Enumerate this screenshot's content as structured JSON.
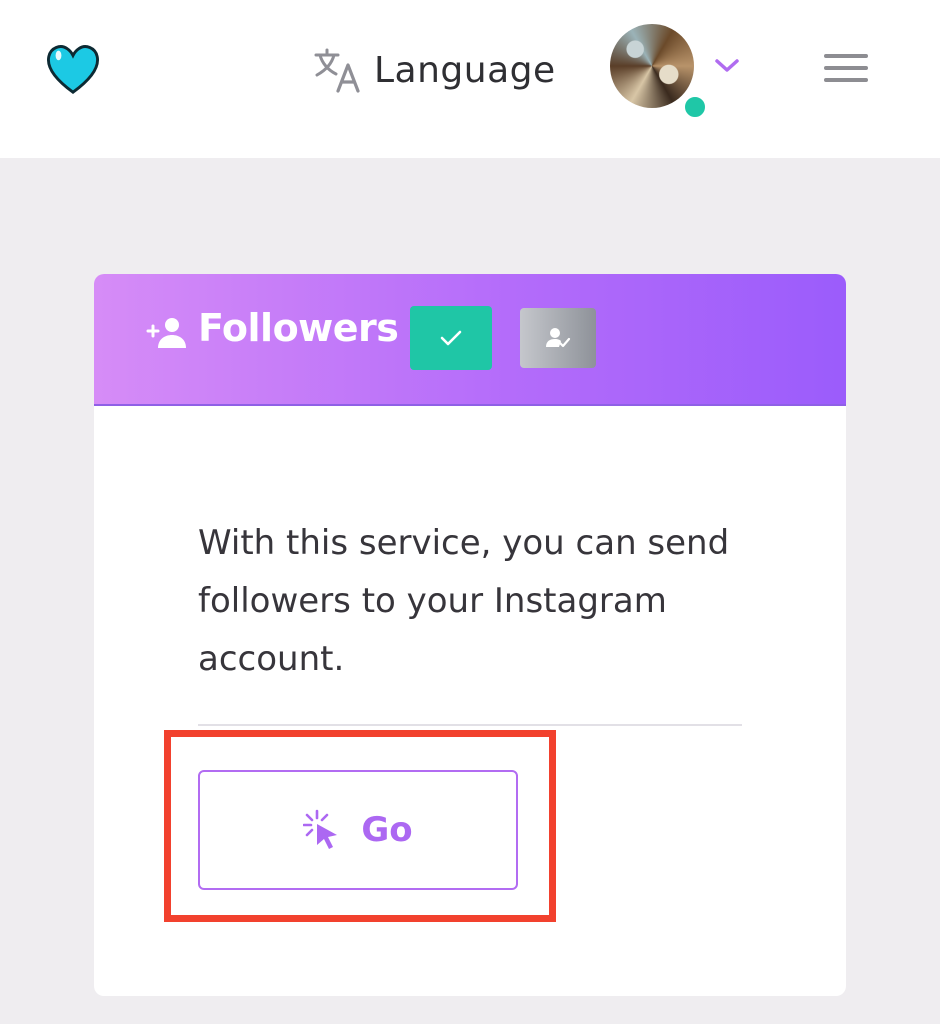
{
  "header": {
    "logo_icon": "heart-icon",
    "language_icon": "translate-icon",
    "language_label": "Language",
    "avatar_icon": "avatar-photo",
    "status_color": "#1fc7a7",
    "dropdown_icon": "chevron-down-icon",
    "menu_icon": "hamburger-menu-icon"
  },
  "card": {
    "title": "Followers",
    "title_icon": "add-person-icon",
    "tags": [
      {
        "icon": "check-icon",
        "color": "#1fc6a6"
      },
      {
        "icon": "user-check-icon",
        "color": "#9ea1a8"
      }
    ],
    "description": "With this service, you can send followers to your Instagram account.",
    "go_button_label": "Go",
    "go_button_icon": "cursor-click-icon",
    "accent_color": "#ac68f2"
  },
  "annotation": {
    "highlight_color": "#f2412e"
  }
}
